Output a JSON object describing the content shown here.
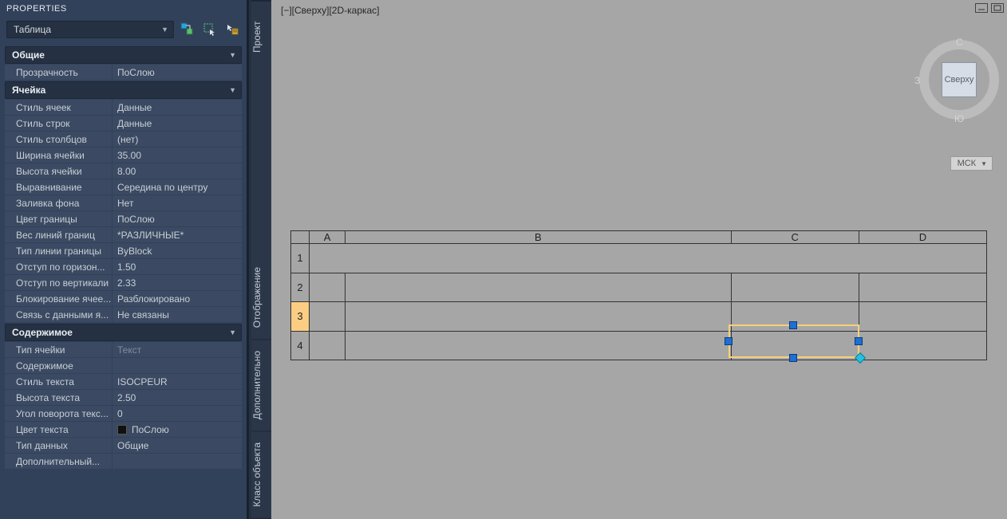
{
  "panel": {
    "title": "PROPERTIES",
    "object_type": "Таблица"
  },
  "sections": {
    "general": {
      "title": "Общие",
      "rows": [
        {
          "label": "Прозрачность",
          "value": "ПоСлою"
        }
      ]
    },
    "cell": {
      "title": "Ячейка",
      "rows": [
        {
          "label": "Стиль ячеек",
          "value": "Данные"
        },
        {
          "label": "Стиль строк",
          "value": "Данные"
        },
        {
          "label": "Стиль столбцов",
          "value": "(нет)"
        },
        {
          "label": "Ширина ячейки",
          "value": "35.00"
        },
        {
          "label": "Высота ячейки",
          "value": "8.00"
        },
        {
          "label": "Выравнивание",
          "value": "Середина по центру"
        },
        {
          "label": "Заливка фона",
          "value": " Нет"
        },
        {
          "label": "Цвет границы",
          "value": "ПоСлою"
        },
        {
          "label": "Вес линий границ",
          "value": "*РАЗЛИЧНЫЕ*"
        },
        {
          "label": "Тип линии границы",
          "value": "ByBlock"
        },
        {
          "label": "Отступ по горизон...",
          "value": "1.50"
        },
        {
          "label": "Отступ по вертикали",
          "value": "2.33"
        },
        {
          "label": "Блокирование ячее...",
          "value": "Разблокировано"
        },
        {
          "label": "Связь с данными я...",
          "value": "Не связаны"
        }
      ]
    },
    "content": {
      "title": "Содержимое",
      "rows": [
        {
          "label": "Тип ячейки",
          "value": "Текст",
          "dim": true
        },
        {
          "label": "Содержимое",
          "value": ""
        },
        {
          "label": "Стиль текста",
          "value": "ISOCPEUR"
        },
        {
          "label": "Высота текста",
          "value": "2.50"
        },
        {
          "label": "Угол поворота текс...",
          "value": "0"
        },
        {
          "label": "Цвет текста",
          "value": "ПоСлою",
          "swatch": true
        },
        {
          "label": "Тип данных",
          "value": "Общие"
        },
        {
          "label": "Дополнительный...",
          "value": ""
        }
      ]
    }
  },
  "side_tabs": [
    "Проект",
    "Отображение",
    "Дополнительно",
    "Класс объекта"
  ],
  "viewport": {
    "label": "[−][Сверху][2D-каркас]",
    "columns": [
      "",
      "A",
      "B",
      "C",
      "D"
    ],
    "rows": [
      "1",
      "2",
      "3",
      "4"
    ],
    "highlighted_column": "C",
    "highlighted_row": "3",
    "cube_face": "Сверху",
    "dir_n": "С",
    "dir_s": "Ю",
    "dir_w": "З",
    "wcs": "МСК"
  }
}
